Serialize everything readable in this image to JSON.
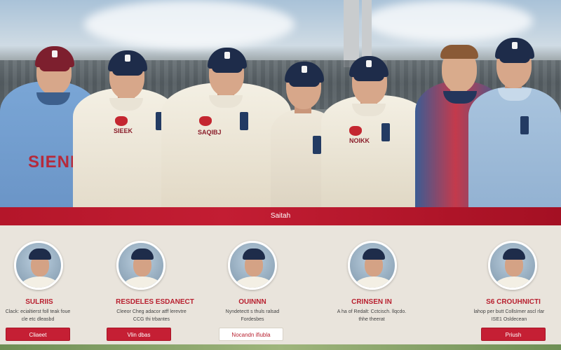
{
  "hero": {
    "shirt_labels": [
      "SIENDA",
      "SIEEK",
      "SAQIBJ",
      "NOIKK"
    ]
  },
  "banner": {
    "title": "Saitah"
  },
  "cards": [
    {
      "name": "SULRIIS",
      "desc_line1": "Clack: ecialtierst foll teak foue",
      "desc_line2": "cle etc dleasbd",
      "button": "Cliaeet",
      "button_style": "primary"
    },
    {
      "name": "RESDELES ESDANECT",
      "desc_line1": "Cleeor Cheg adacor atff lerevtre",
      "desc_line2": "CCG thi trbantes",
      "button": "Vlin dbas",
      "button_style": "primary"
    },
    {
      "name": "OUINNN",
      "desc_line1": "Nyndetectt s thuls ralsad",
      "desc_line2": "Fordesbes",
      "button": "Nocandn ifiubla",
      "button_style": "light"
    },
    {
      "name": "CRINSEN IN",
      "desc_line1": "A ha of Redalt: Cctcisch. llqcdo.",
      "desc_line2": "thhe theerat",
      "button": "",
      "button_style": "none"
    },
    {
      "name": "S6 CROUHNICTI",
      "desc_line1": "lahop per butt CollsImer ascl rlar",
      "desc_line2": "ISE1 Osldecean",
      "button": "Priush",
      "button_style": "primary"
    }
  ],
  "colors": {
    "accent_red": "#c31d33",
    "cream": "#e9e4dc",
    "navy_cap": "#1e2c4a"
  }
}
